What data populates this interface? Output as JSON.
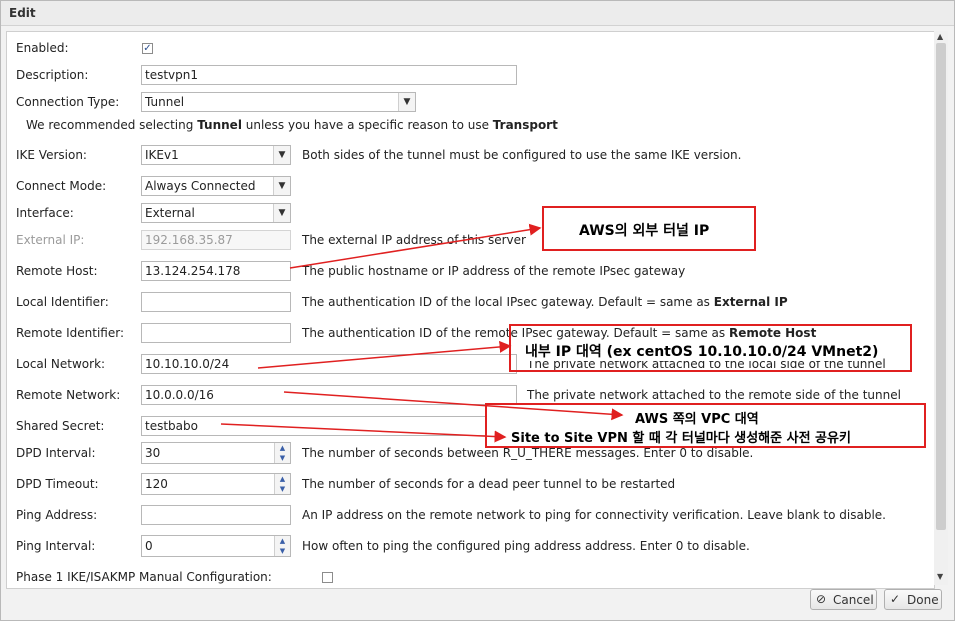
{
  "dialog": {
    "title": "Edit"
  },
  "form": {
    "enabled_label": "Enabled:",
    "enabled_checked": true,
    "description_label": "Description:",
    "description_value": "testvpn1",
    "connection_type_label": "Connection Type:",
    "connection_type_value": "Tunnel",
    "recommend_prefix": "We recommended selecting ",
    "recommend_tunnel": "Tunnel",
    "recommend_middle": " unless you have a specific reason to use ",
    "recommend_transport": "Transport",
    "ike_version_label": "IKE Version:",
    "ike_version_value": "IKEv1",
    "ike_version_help": "Both sides of the tunnel must be configured to use the same IKE version.",
    "connect_mode_label": "Connect Mode:",
    "connect_mode_value": "Always Connected",
    "interface_label": "Interface:",
    "interface_value": "External",
    "external_ip_label": "External IP:",
    "external_ip_value": "192.168.35.87",
    "external_ip_help": "The external IP address of this server",
    "remote_host_label": "Remote Host:",
    "remote_host_value": "13.124.254.178",
    "remote_host_help": "The public hostname or IP address of the remote IPsec gateway",
    "local_identifier_label": "Local Identifier:",
    "local_identifier_value": "",
    "local_identifier_help": "The authentication ID of the local IPsec gateway. Default = same as ",
    "local_identifier_help_bold": "External IP",
    "remote_identifier_label": "Remote Identifier:",
    "remote_identifier_value": "",
    "remote_identifier_help": "The authentication ID of the remote IPsec gateway. Default = same as ",
    "remote_identifier_help_bold": "Remote Host",
    "local_network_label": "Local Network:",
    "local_network_value": "10.10.10.0/24",
    "local_network_help": "The private network attached to the local side of the tunnel",
    "remote_network_label": "Remote Network:",
    "remote_network_value": "10.0.0.0/16",
    "remote_network_help": "The private network attached to the remote side of the tunnel",
    "shared_secret_label": "Shared Secret:",
    "shared_secret_value": "testbabo",
    "dpd_interval_label": "DPD Interval:",
    "dpd_interval_value": "30",
    "dpd_interval_help": "The number of seconds between R_U_THERE messages. Enter 0 to disable.",
    "dpd_timeout_label": "DPD Timeout:",
    "dpd_timeout_value": "120",
    "dpd_timeout_help": "The number of seconds for a dead peer tunnel to be restarted",
    "ping_address_label": "Ping Address:",
    "ping_address_value": "",
    "ping_address_help": "An IP address on the remote network to ping for connectivity verification. Leave blank to disable.",
    "ping_interval_label": "Ping Interval:",
    "ping_interval_value": "0",
    "ping_interval_help": "How often to ping the configured ping address address. Enter 0 to disable.",
    "phase1_label": "Phase 1 IKE/ISAKMP Manual Configuration:",
    "phase1_checked": false
  },
  "annotations": {
    "aws_external_ip": "AWS의 외부 터널 IP",
    "internal_ip_range": "내부 IP 대역 (ex centOS 10.10.10.0/24 VMnet2)",
    "aws_vpc_range": "AWS 쪽의 VPC 대역",
    "psk_note": "Site to Site VPN 할 때 각 터널마다 생성해준 사전 공유키"
  },
  "footer": {
    "cancel_label": "Cancel",
    "done_label": "Done"
  },
  "icons": {
    "dropdown": "chevron-down-icon",
    "spinner": "spinner-arrows-icon",
    "cancel": "cancel-circle-icon",
    "done": "checkmark-icon"
  },
  "colors": {
    "annotation": "#e02020"
  }
}
